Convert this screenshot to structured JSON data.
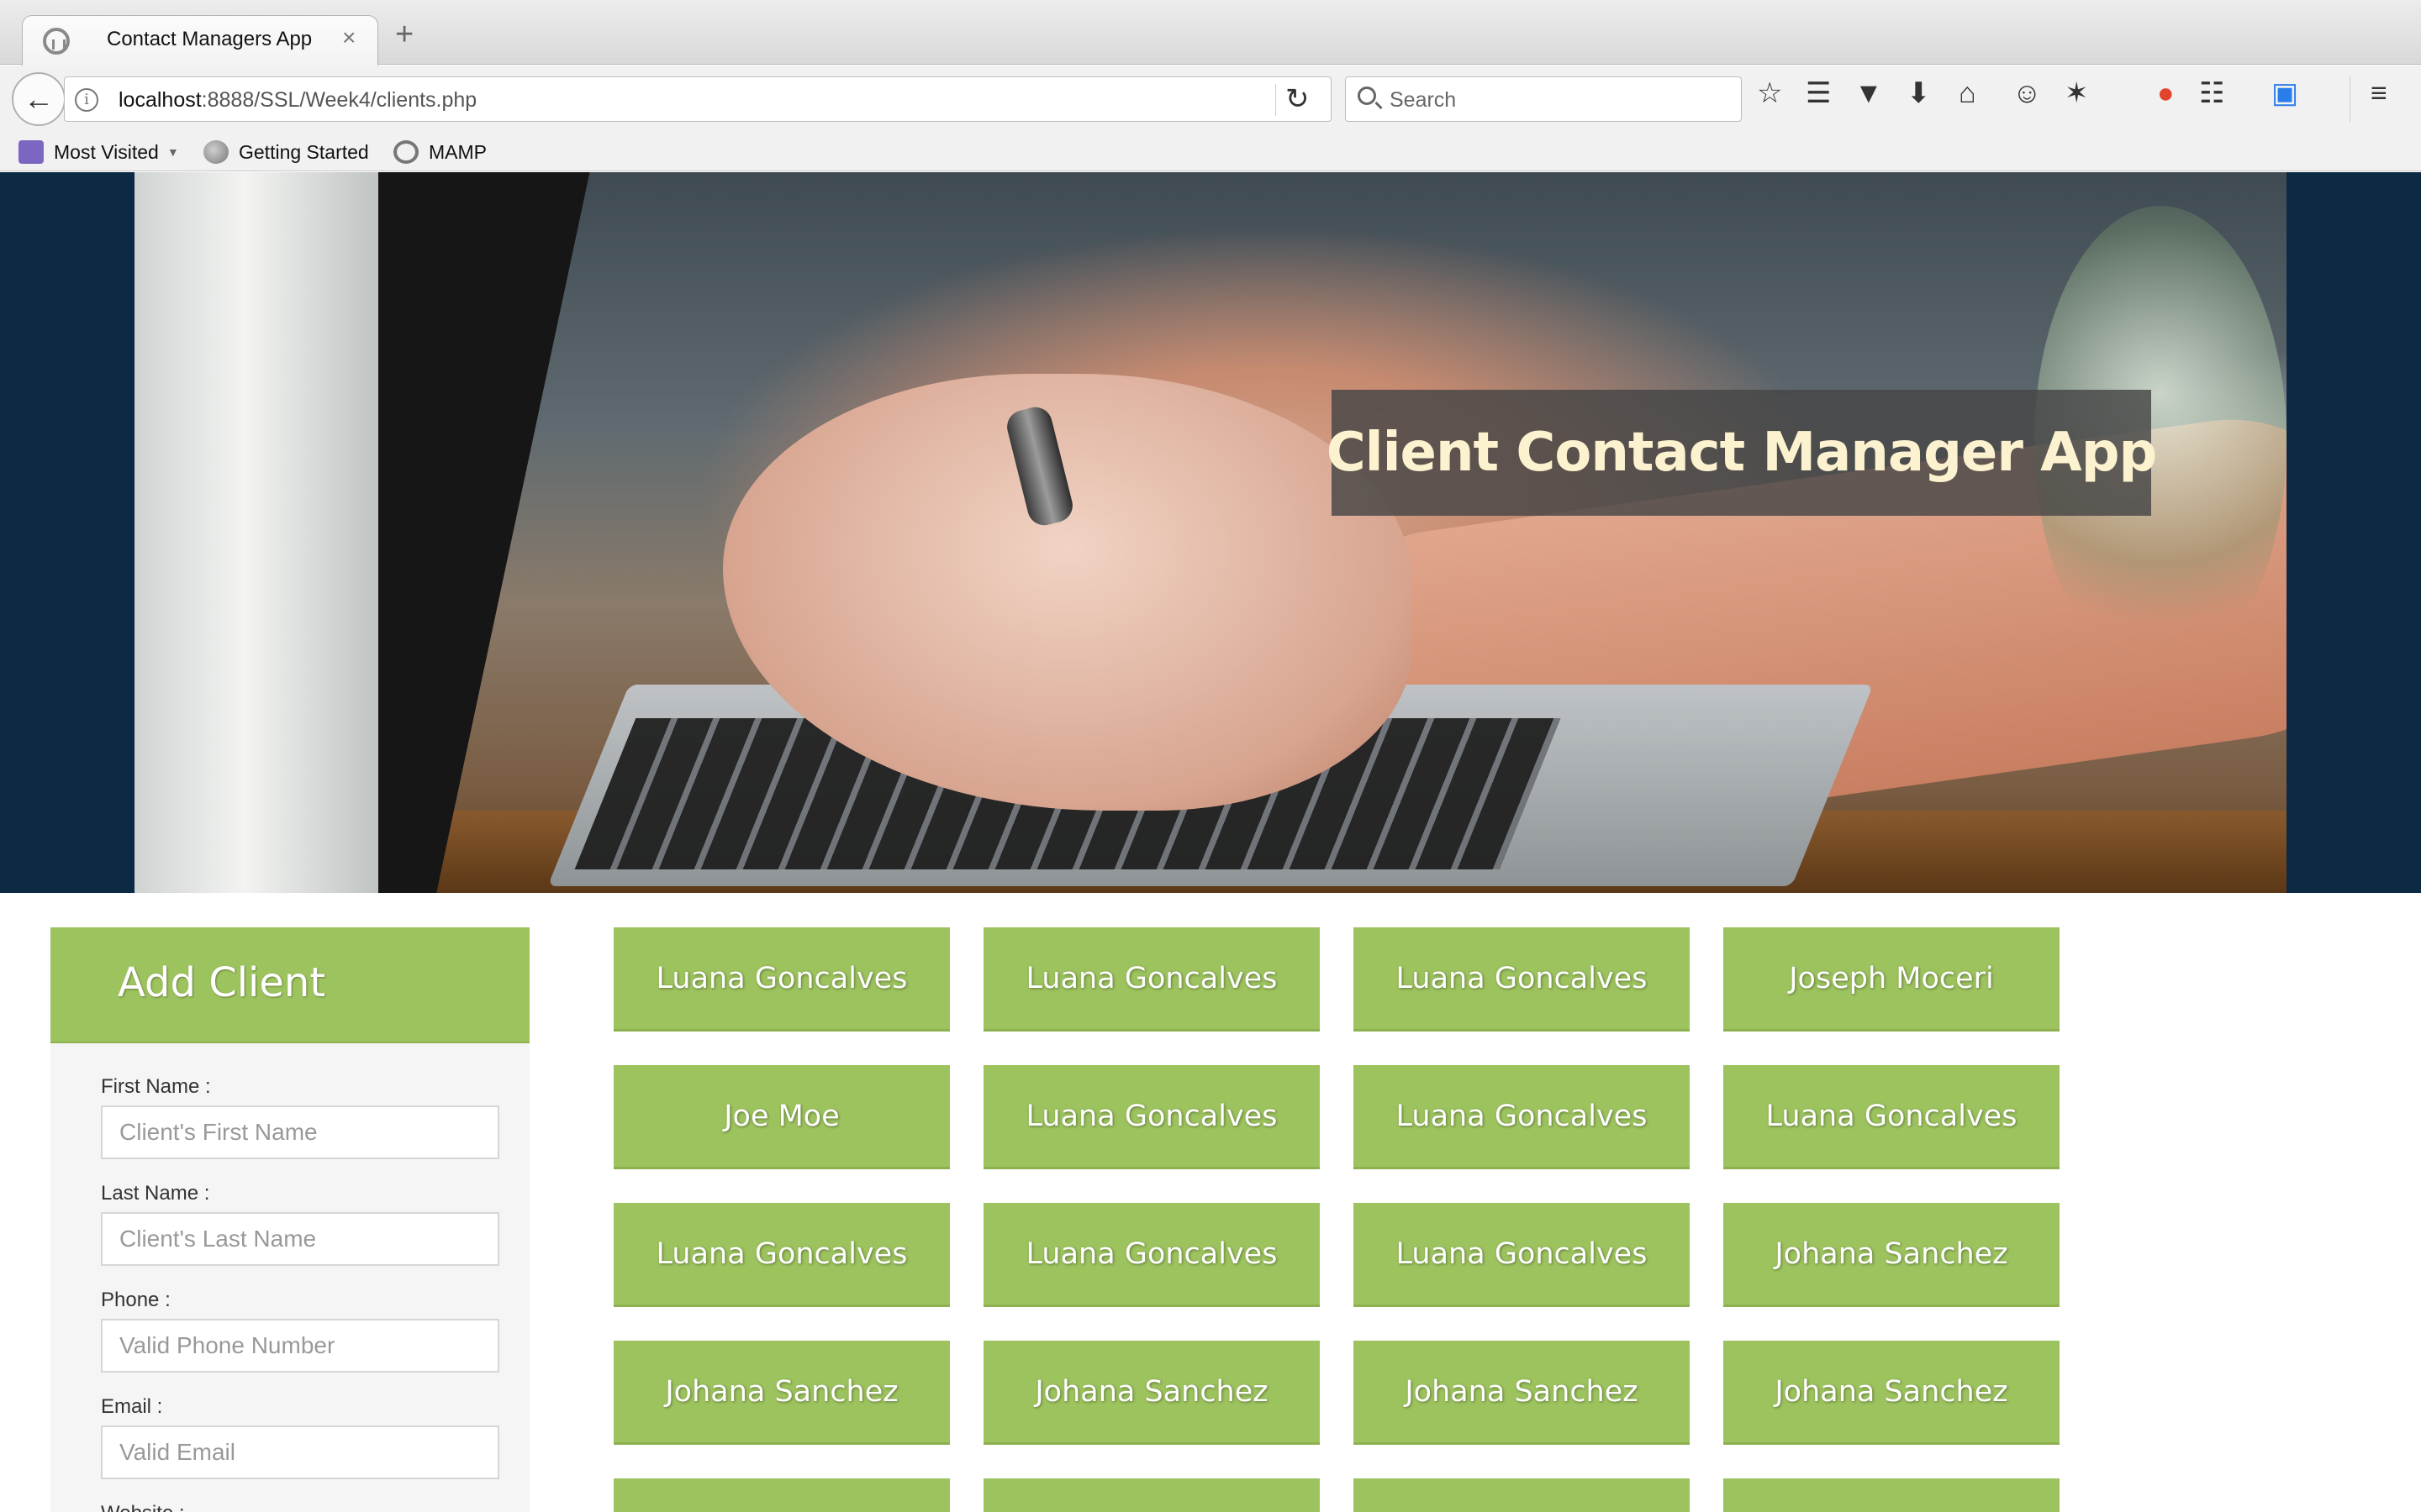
{
  "browser": {
    "tab_title": "Contact Managers App",
    "tab_close": "×",
    "new_tab": "+",
    "url_host": "localhost",
    "url_rest": ":8888/SSL/Week4/clients.php",
    "search_placeholder": "Search",
    "bookmarks": [
      "Most Visited",
      "Getting Started",
      "MAMP"
    ]
  },
  "hero": {
    "title": "Client Contact Manager App"
  },
  "form": {
    "title": "Add Client",
    "fields": [
      {
        "label": "First Name :",
        "placeholder": "Client's First Name"
      },
      {
        "label": "Last Name :",
        "placeholder": "Client's Last Name"
      },
      {
        "label": "Phone :",
        "placeholder": "Valid Phone Number"
      },
      {
        "label": "Email :",
        "placeholder": "Valid Email"
      },
      {
        "label": "Website :",
        "placeholder": ""
      }
    ]
  },
  "clients": [
    "Luana Goncalves",
    "Luana Goncalves",
    "Luana Goncalves",
    "Joseph Moceri",
    "Joe Moe",
    "Luana Goncalves",
    "Luana Goncalves",
    "Luana Goncalves",
    "Luana Goncalves",
    "Luana Goncalves",
    "Luana Goncalves",
    "Johana Sanchez",
    "Johana Sanchez",
    "Johana Sanchez",
    "Johana Sanchez",
    "Johana Sanchez",
    "",
    "",
    "",
    ""
  ],
  "colors": {
    "accent_green": "#9dc35e",
    "hero_side_navy": "#0d2a44",
    "hero_title_text": "#fdf2cf"
  }
}
